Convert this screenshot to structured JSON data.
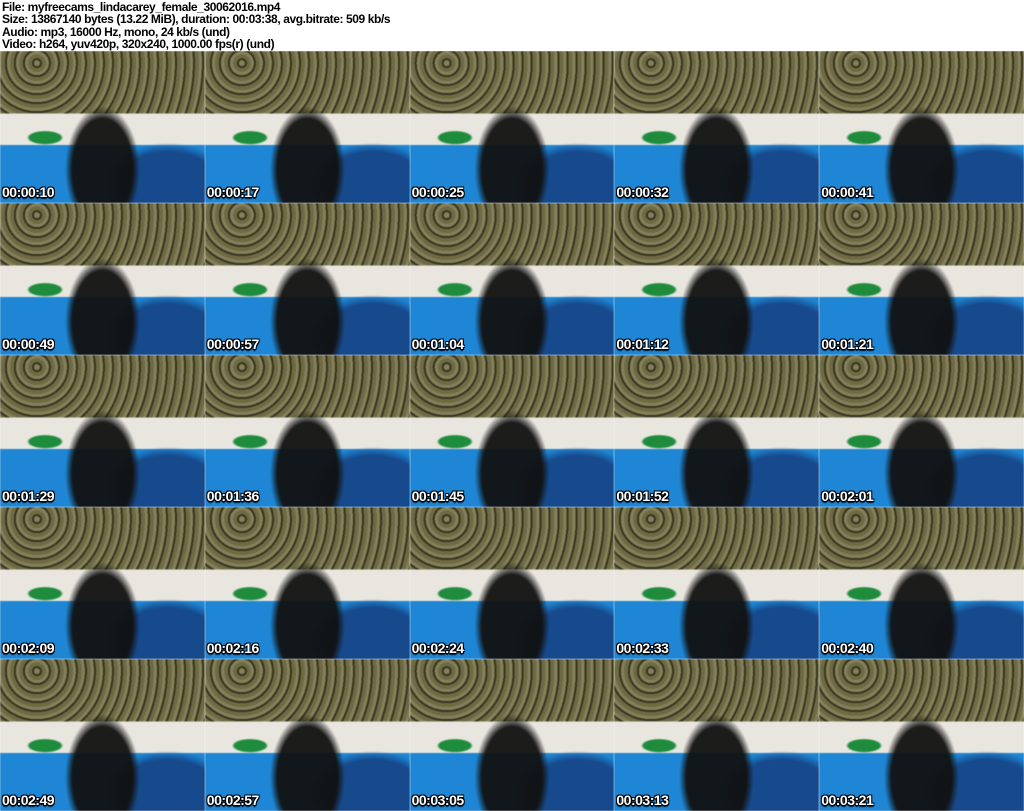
{
  "header": {
    "lines": [
      "File: myfreecams_lindacarey_female_30062016.mp4",
      "Size: 13867140 bytes (13.22 MiB), duration: 00:03:38, avg.bitrate: 509 kb/s",
      "Audio: mp3, 16000 Hz, mono, 24 kb/s (und)",
      "Video: h264, yuv420p, 320x240, 1000.00 fps(r) (und)"
    ]
  },
  "grid": {
    "columns": 5,
    "rows": 5,
    "thumbnails": [
      {
        "timestamp": "00:00:10"
      },
      {
        "timestamp": "00:00:17"
      },
      {
        "timestamp": "00:00:25"
      },
      {
        "timestamp": "00:00:32"
      },
      {
        "timestamp": "00:00:41"
      },
      {
        "timestamp": "00:00:49"
      },
      {
        "timestamp": "00:00:57"
      },
      {
        "timestamp": "00:01:04"
      },
      {
        "timestamp": "00:01:12"
      },
      {
        "timestamp": "00:01:21"
      },
      {
        "timestamp": "00:01:29"
      },
      {
        "timestamp": "00:01:36"
      },
      {
        "timestamp": "00:01:45"
      },
      {
        "timestamp": "00:01:52"
      },
      {
        "timestamp": "00:02:01"
      },
      {
        "timestamp": "00:02:09"
      },
      {
        "timestamp": "00:02:16"
      },
      {
        "timestamp": "00:02:24"
      },
      {
        "timestamp": "00:02:33"
      },
      {
        "timestamp": "00:02:40"
      },
      {
        "timestamp": "00:02:49"
      },
      {
        "timestamp": "00:02:57"
      },
      {
        "timestamp": "00:03:05"
      },
      {
        "timestamp": "00:03:13"
      },
      {
        "timestamp": "00:03:21"
      }
    ]
  },
  "colors": {
    "header_background": "#ffffff",
    "header_text": "#000000",
    "timestamp_text": "#ffffff",
    "timestamp_outline": "#000000",
    "wall_pattern_light": "#86815a",
    "wall_pattern_dark": "#35331f",
    "headboard": "#e9e6df",
    "bedding_blue": "#1e86d4",
    "bedding_navy": "#174a8c",
    "pillow_green": "#1e8c3c",
    "silhouette_dark": "#111111"
  }
}
